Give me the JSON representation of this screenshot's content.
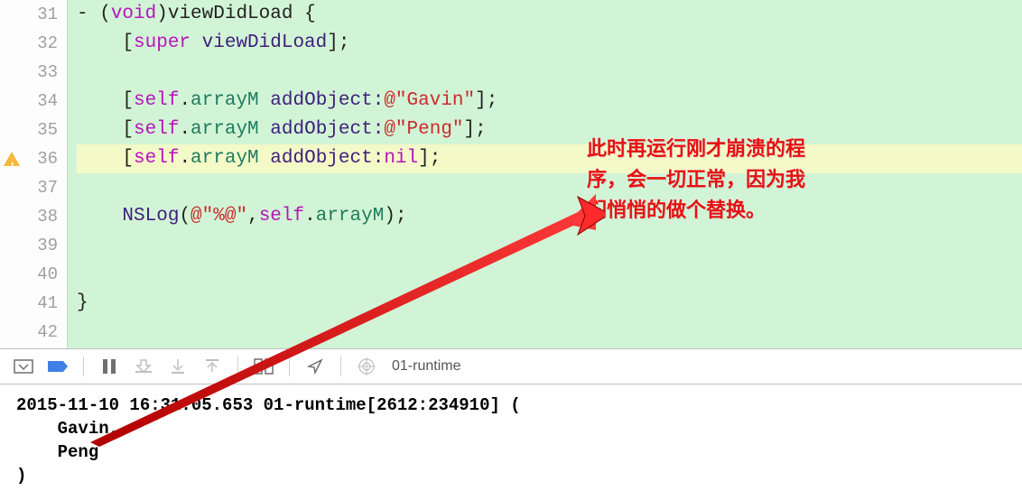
{
  "gutter": [
    "31",
    "32",
    "33",
    "34",
    "35",
    "36",
    "37",
    "38",
    "39",
    "40",
    "41",
    "42"
  ],
  "warn_line_index": 5,
  "code": {
    "l31": {
      "pre": "- (",
      "void": "void",
      "rest": ")",
      "meth": "viewDidLoad",
      "tail": " {"
    },
    "l32": {
      "indent": "    [",
      "super": "super",
      "sp": " ",
      "meth": "viewDidLoad",
      "tail": "];"
    },
    "l33": "",
    "l34": {
      "indent": "    [",
      "self": "self",
      "dot": ".",
      "arr": "arrayM",
      "sp": " ",
      "meth": "addObject:",
      "at": "@",
      "str": "\"Gavin\"",
      "tail": "];"
    },
    "l35": {
      "indent": "    [",
      "self": "self",
      "dot": ".",
      "arr": "arrayM",
      "sp": " ",
      "meth": "addObject:",
      "at": "@",
      "str": "\"Peng\"",
      "tail": "];"
    },
    "l36": {
      "indent": "    [",
      "self": "self",
      "dot": ".",
      "arr": "arrayM",
      "sp": " ",
      "meth": "addObject:",
      "nil": "nil",
      "tail": "];"
    },
    "l37": "",
    "l38": {
      "indent": "    ",
      "nslog": "NSLog",
      "open": "(",
      "at": "@",
      "str": "\"%@\"",
      "comma": ",",
      "self": "self",
      "dot": ".",
      "arr": "arrayM",
      "tail": ");"
    },
    "l39": "",
    "l40": "",
    "l41": "}",
    "l42": ""
  },
  "annotation": "此时再运行刚才崩溃的程序，会一切正常，因为我们悄悄的做个替换。",
  "toolbar": {
    "title": "01-runtime"
  },
  "console": "2015-11-10 16:31:05.653 01-runtime[2612:234910] (\n    Gavin,\n    Peng\n)"
}
